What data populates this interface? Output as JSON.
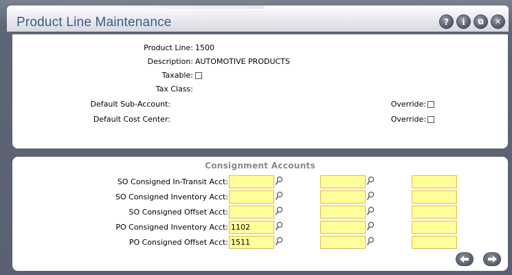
{
  "window": {
    "title": "Product Line Maintenance"
  },
  "titlebar_buttons": [
    {
      "name": "help-button",
      "glyph": "?"
    },
    {
      "name": "info-button",
      "glyph": "i"
    },
    {
      "name": "restore-button",
      "glyph": "⧉"
    },
    {
      "name": "close-button",
      "glyph": "✕"
    }
  ],
  "header": {
    "product_line_label": "Product Line:",
    "product_line_value": "1500",
    "description_label": "Description:",
    "description_value": "AUTOMOTIVE PRODUCTS",
    "taxable_label": "Taxable:",
    "tax_class_label": "Tax Class:",
    "sub_account_label": "Default Sub-Account:",
    "cost_center_label": "Default Cost Center:",
    "override_label": "Override:"
  },
  "consignment": {
    "title": "Consignment Accounts",
    "rows": [
      {
        "label": "SO Consigned In-Transit Acct:",
        "values": [
          "",
          "",
          ""
        ]
      },
      {
        "label": "SO Consigned Inventory Acct:",
        "values": [
          "",
          "",
          ""
        ]
      },
      {
        "label": "SO Consigned Offset Acct:",
        "values": [
          "",
          "",
          ""
        ]
      },
      {
        "label": "PO Consigned Inventory Acct:",
        "values": [
          "1102",
          "",
          ""
        ]
      },
      {
        "label": "PO Consigned Offset Acct:",
        "values": [
          "1511",
          "",
          ""
        ]
      }
    ]
  },
  "colors": {
    "title_text": "#3d5a8a",
    "field_bg": "#ffff9a",
    "field_border": "#e5b84a",
    "section_title": "#888888",
    "chrome": "#5e6575"
  },
  "icons": {
    "lookup": "magnifier-icon",
    "prev": "arrow-left-icon",
    "next": "arrow-right-icon"
  }
}
